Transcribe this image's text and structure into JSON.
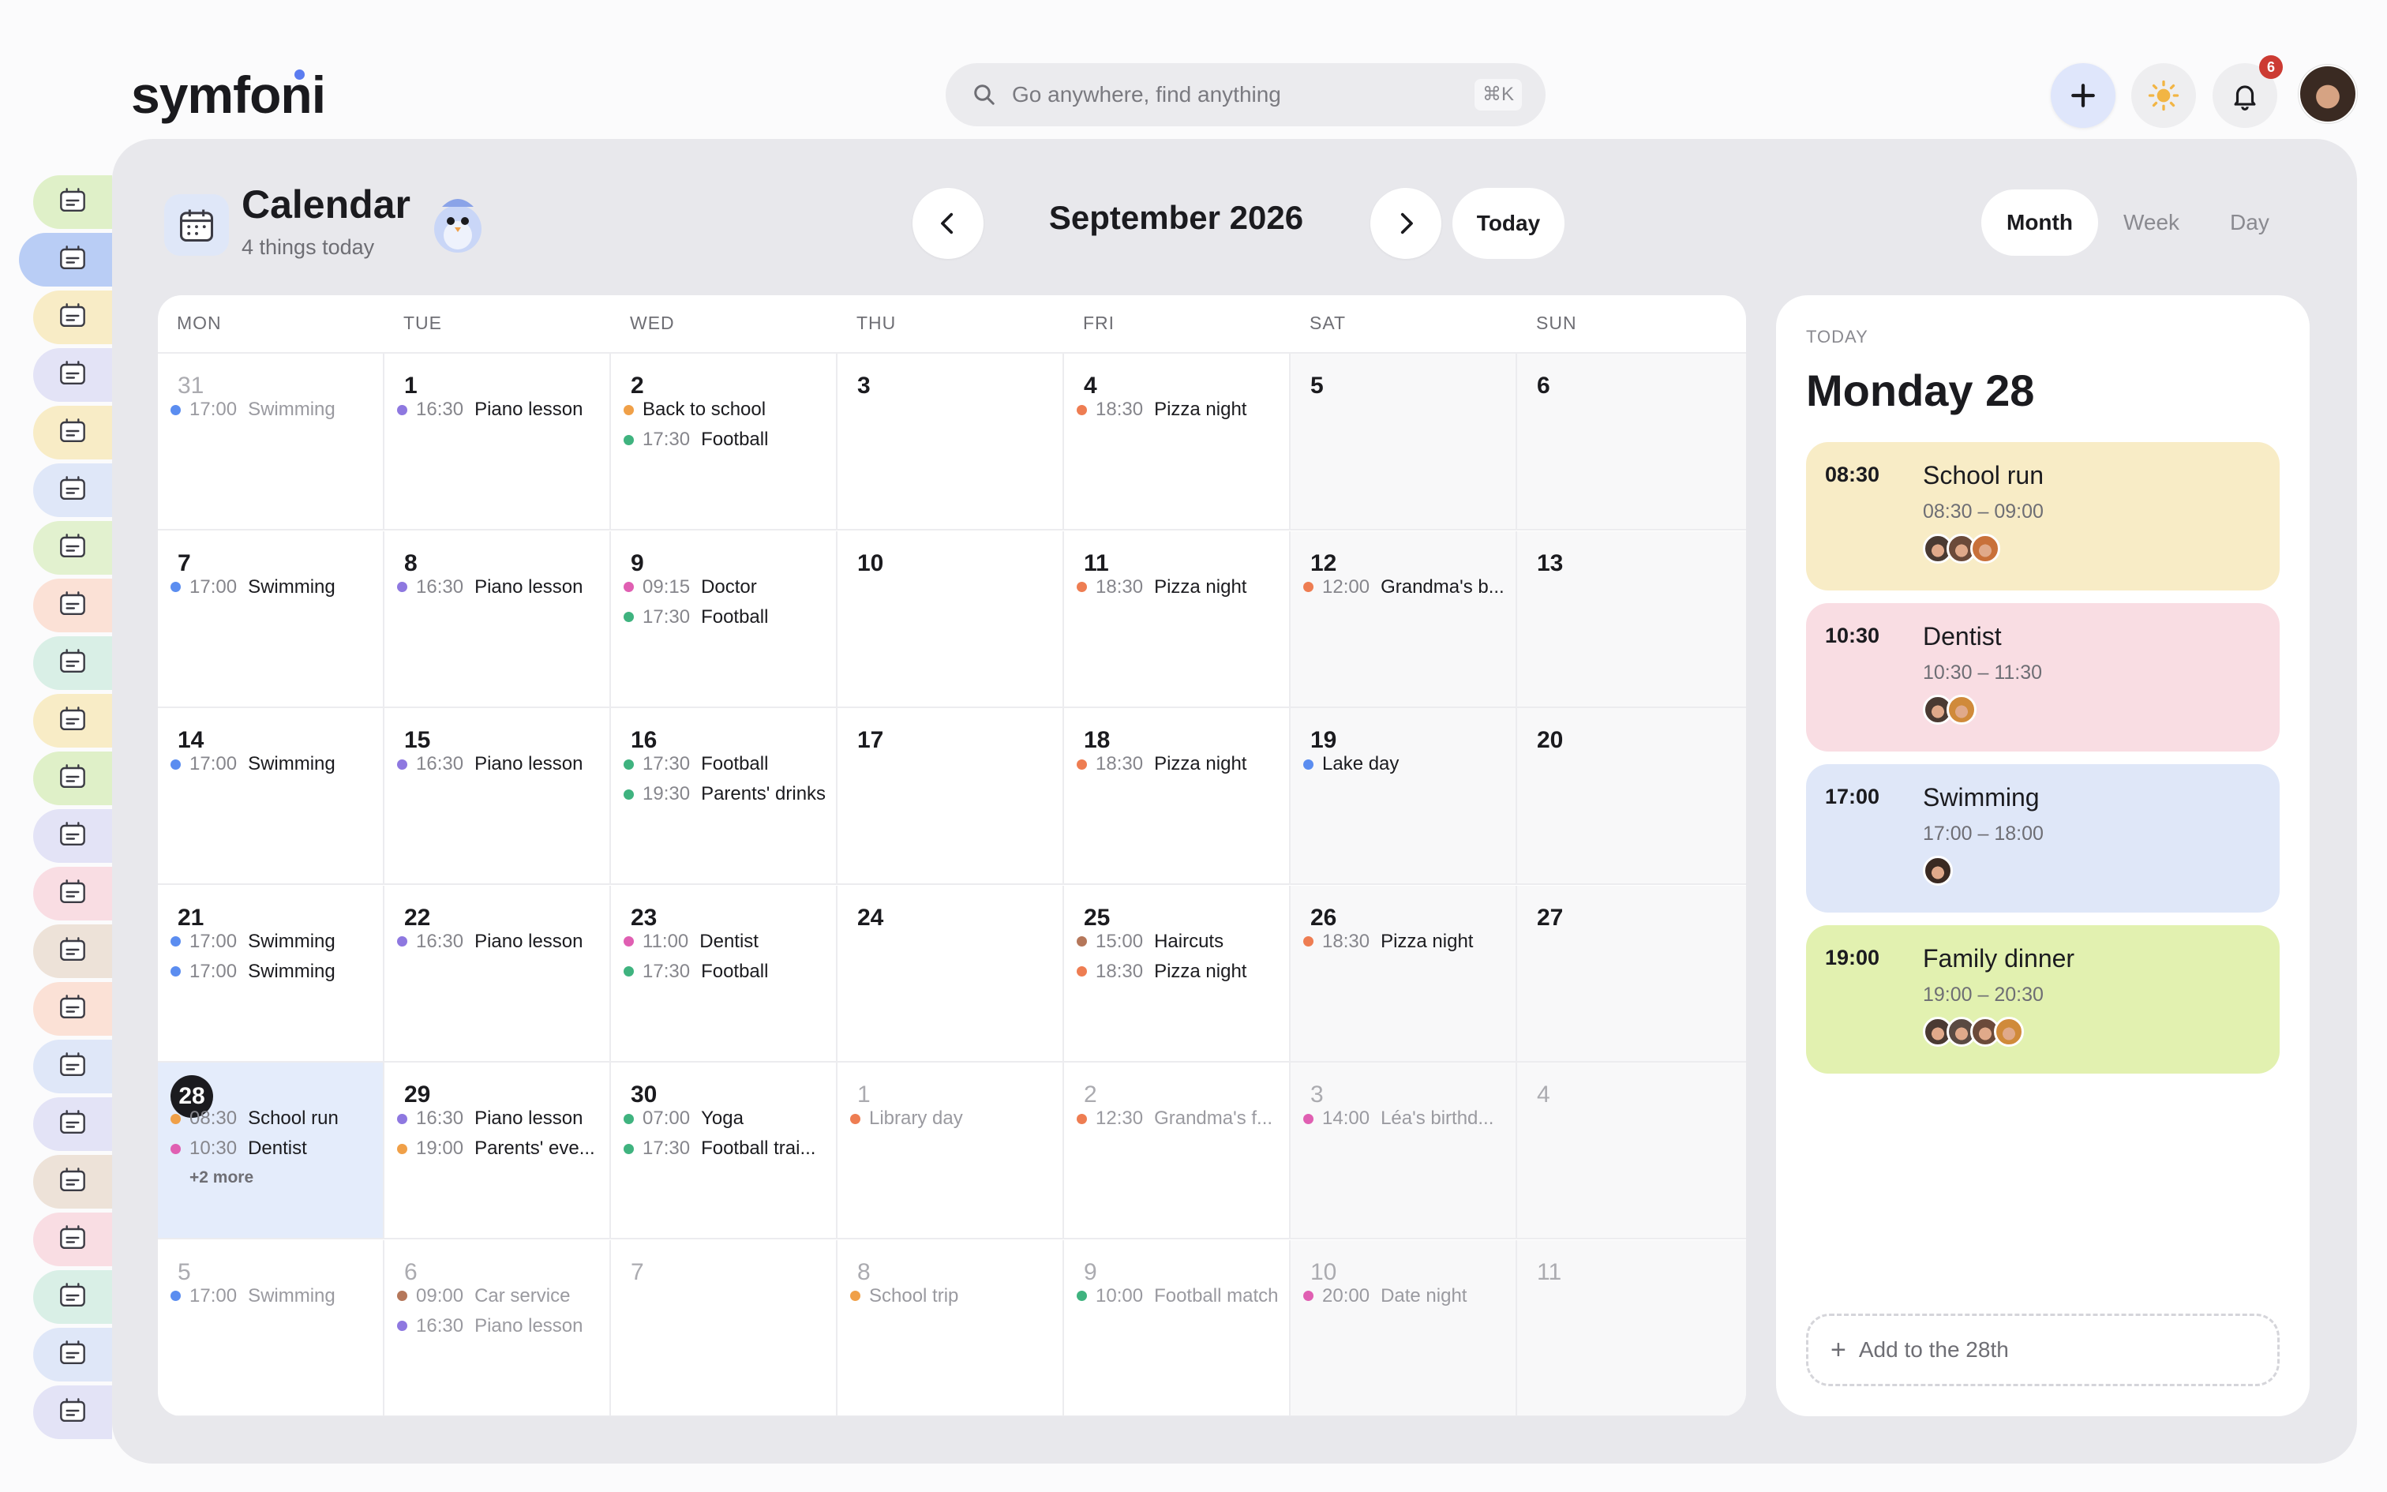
{
  "app": {
    "logo_text": "symfoni"
  },
  "search": {
    "placeholder": "Go anywhere, find anything",
    "shortcut": "⌘K"
  },
  "topbar": {
    "notification_count": "6"
  },
  "sidebar": {
    "items": [
      {
        "icon": "home-icon",
        "bg": "#dff0c8"
      },
      {
        "icon": "calendar-icon",
        "bg": "#b9cdf5",
        "active": true
      },
      {
        "icon": "tickets-icon",
        "bg": "#f8ecc6"
      },
      {
        "icon": "car-icon",
        "bg": "#e3e3f6"
      },
      {
        "icon": "broom-icon",
        "bg": "#f8ecc6"
      },
      {
        "icon": "checklist-icon",
        "bg": "#dfe7f8"
      },
      {
        "icon": "recipe-icon",
        "bg": "#e2f1cf"
      },
      {
        "icon": "plate-icon",
        "bg": "#fbe1d6"
      },
      {
        "icon": "planner-icon",
        "bg": "#d9efe6"
      },
      {
        "icon": "backpack-icon",
        "bg": "#f8ecc6"
      },
      {
        "icon": "vehicle-icon",
        "bg": "#dff0c8"
      },
      {
        "icon": "garden-icon",
        "bg": "#e3e3f6"
      },
      {
        "icon": "camera-icon",
        "bg": "#f9dde3"
      },
      {
        "icon": "toolbox-icon",
        "bg": "#ede2d8"
      },
      {
        "icon": "pet-icon",
        "bg": "#fbe1d6"
      },
      {
        "icon": "weather-icon",
        "bg": "#dfe7f8"
      },
      {
        "icon": "book-icon",
        "bg": "#e3e3f6"
      },
      {
        "icon": "photo-icon",
        "bg": "#ede2d8"
      },
      {
        "icon": "mail-heart-icon",
        "bg": "#f9dde3"
      },
      {
        "icon": "house-care-icon",
        "bg": "#d9efe6"
      },
      {
        "icon": "reading-icon",
        "bg": "#dfe7f8"
      },
      {
        "icon": "baby-icon",
        "bg": "#e3e3f6"
      }
    ]
  },
  "header": {
    "title": "Calendar",
    "subtitle": "4 things today",
    "month_label": "September 2026",
    "today_label": "Today"
  },
  "views": [
    "Month",
    "Week",
    "Day"
  ],
  "selected_view": "Month",
  "weekdays": [
    "MON",
    "TUE",
    "WED",
    "THU",
    "FRI",
    "SAT",
    "SUN"
  ],
  "colors": {
    "blue": "#5b8df0",
    "purple": "#8e78e0",
    "orange": "#f0a048",
    "green": "#3fb37f",
    "coral": "#ee7d52",
    "pink": "#e05fb2",
    "brown": "#b5775a"
  },
  "weeks": [
    [
      {
        "day": "31",
        "muted": true,
        "events": [
          {
            "time": "17:00",
            "name": "Swimming",
            "color": "#5b8df0"
          }
        ]
      },
      {
        "day": "1",
        "events": [
          {
            "time": "16:30",
            "name": "Piano lesson",
            "color": "#8e78e0"
          }
        ]
      },
      {
        "day": "2",
        "events": [
          {
            "time": "",
            "name": "Back to school",
            "color": "#f0a048"
          },
          {
            "time": "17:30",
            "name": "Football",
            "color": "#3fb37f"
          }
        ]
      },
      {
        "day": "3",
        "events": []
      },
      {
        "day": "4",
        "events": [
          {
            "time": "18:30",
            "name": "Pizza night",
            "color": "#ee7d52"
          }
        ]
      },
      {
        "day": "5",
        "weekend": true,
        "events": []
      },
      {
        "day": "6",
        "weekend": true,
        "events": []
      }
    ],
    [
      {
        "day": "7",
        "events": [
          {
            "time": "17:00",
            "name": "Swimming",
            "color": "#5b8df0"
          }
        ]
      },
      {
        "day": "8",
        "events": [
          {
            "time": "16:30",
            "name": "Piano lesson",
            "color": "#8e78e0"
          }
        ]
      },
      {
        "day": "9",
        "events": [
          {
            "time": "09:15",
            "name": "Doctor",
            "color": "#e05fb2"
          },
          {
            "time": "17:30",
            "name": "Football",
            "color": "#3fb37f"
          }
        ]
      },
      {
        "day": "10",
        "events": []
      },
      {
        "day": "11",
        "events": [
          {
            "time": "18:30",
            "name": "Pizza night",
            "color": "#ee7d52"
          }
        ]
      },
      {
        "day": "12",
        "weekend": true,
        "events": [
          {
            "time": "12:00",
            "name": "Grandma's b...",
            "color": "#ee7d52"
          }
        ]
      },
      {
        "day": "13",
        "weekend": true,
        "events": []
      }
    ],
    [
      {
        "day": "14",
        "events": [
          {
            "time": "17:00",
            "name": "Swimming",
            "color": "#5b8df0"
          }
        ]
      },
      {
        "day": "15",
        "events": [
          {
            "time": "16:30",
            "name": "Piano lesson",
            "color": "#8e78e0"
          }
        ]
      },
      {
        "day": "16",
        "events": [
          {
            "time": "17:30",
            "name": "Football",
            "color": "#3fb37f"
          },
          {
            "time": "19:30",
            "name": "Parents' drinks",
            "color": "#3fb37f"
          }
        ]
      },
      {
        "day": "17",
        "events": []
      },
      {
        "day": "18",
        "events": [
          {
            "time": "18:30",
            "name": "Pizza night",
            "color": "#ee7d52"
          }
        ]
      },
      {
        "day": "19",
        "weekend": true,
        "events": [
          {
            "time": "",
            "name": "Lake day",
            "color": "#5b8df0"
          }
        ]
      },
      {
        "day": "20",
        "weekend": true,
        "events": []
      }
    ],
    [
      {
        "day": "21",
        "events": [
          {
            "time": "17:00",
            "name": "Swimming",
            "color": "#5b8df0"
          },
          {
            "time": "17:00",
            "name": "Swimming",
            "color": "#5b8df0"
          }
        ]
      },
      {
        "day": "22",
        "events": [
          {
            "time": "16:30",
            "name": "Piano lesson",
            "color": "#8e78e0"
          }
        ]
      },
      {
        "day": "23",
        "events": [
          {
            "time": "11:00",
            "name": "Dentist",
            "color": "#e05fb2"
          },
          {
            "time": "17:30",
            "name": "Football",
            "color": "#3fb37f"
          }
        ]
      },
      {
        "day": "24",
        "events": []
      },
      {
        "day": "25",
        "events": [
          {
            "time": "15:00",
            "name": "Haircuts",
            "color": "#b5775a"
          },
          {
            "time": "18:30",
            "name": "Pizza night",
            "color": "#ee7d52"
          }
        ]
      },
      {
        "day": "26",
        "weekend": true,
        "events": [
          {
            "time": "18:30",
            "name": "Pizza night",
            "color": "#ee7d52"
          }
        ]
      },
      {
        "day": "27",
        "weekend": true,
        "events": []
      }
    ],
    [
      {
        "day": "28",
        "today": true,
        "events": [
          {
            "time": "08:30",
            "name": "School run",
            "color": "#f0a048"
          },
          {
            "time": "10:30",
            "name": "Dentist",
            "color": "#e05fb2"
          }
        ],
        "more": "+2 more"
      },
      {
        "day": "29",
        "events": [
          {
            "time": "16:30",
            "name": "Piano lesson",
            "color": "#8e78e0"
          },
          {
            "time": "19:00",
            "name": "Parents' eve...",
            "color": "#f0a048"
          }
        ]
      },
      {
        "day": "30",
        "events": [
          {
            "time": "07:00",
            "name": "Yoga",
            "color": "#3fb37f"
          },
          {
            "time": "17:30",
            "name": "Football trai...",
            "color": "#3fb37f"
          }
        ]
      },
      {
        "day": "1",
        "muted": true,
        "events": [
          {
            "time": "",
            "name": "Library day",
            "color": "#ee7d52"
          }
        ]
      },
      {
        "day": "2",
        "muted": true,
        "events": [
          {
            "time": "12:30",
            "name": "Grandma's f...",
            "color": "#ee7d52"
          }
        ]
      },
      {
        "day": "3",
        "muted": true,
        "weekend": true,
        "events": [
          {
            "time": "14:00",
            "name": "Léa's birthd...",
            "color": "#e05fb2"
          }
        ]
      },
      {
        "day": "4",
        "muted": true,
        "weekend": true,
        "events": []
      }
    ],
    [
      {
        "day": "5",
        "muted": true,
        "events": [
          {
            "time": "17:00",
            "name": "Swimming",
            "color": "#5b8df0"
          }
        ]
      },
      {
        "day": "6",
        "muted": true,
        "events": [
          {
            "time": "09:00",
            "name": "Car service",
            "color": "#b5775a"
          },
          {
            "time": "16:30",
            "name": "Piano lesson",
            "color": "#8e78e0"
          }
        ]
      },
      {
        "day": "7",
        "muted": true,
        "events": []
      },
      {
        "day": "8",
        "muted": true,
        "events": [
          {
            "time": "",
            "name": "School trip",
            "color": "#f0a048"
          }
        ]
      },
      {
        "day": "9",
        "muted": true,
        "events": [
          {
            "time": "10:00",
            "name": "Football match",
            "color": "#3fb37f"
          }
        ]
      },
      {
        "day": "10",
        "muted": true,
        "weekend": true,
        "events": [
          {
            "time": "20:00",
            "name": "Date night",
            "color": "#e05fb2"
          }
        ]
      },
      {
        "day": "11",
        "muted": true,
        "weekend": true,
        "events": []
      }
    ]
  ],
  "today_panel": {
    "label": "TODAY",
    "day_title": "Monday 28",
    "events": [
      {
        "time": "08:30",
        "title": "School run",
        "range": "08:30 – 09:00",
        "bg": "#f8ecc6",
        "faces": [
          "#4a3a32",
          "#6b4a3a",
          "#c8703a"
        ]
      },
      {
        "time": "10:30",
        "title": "Dentist",
        "range": "10:30 – 11:30",
        "bg": "#f9dde3",
        "faces": [
          "#4a3a32",
          "#d08a3a"
        ]
      },
      {
        "time": "17:00",
        "title": "Swimming",
        "range": "17:00 – 18:00",
        "bg": "#dfe7f8",
        "faces": [
          "#3a2a22"
        ]
      },
      {
        "time": "19:00",
        "title": "Family dinner",
        "range": "19:00 – 20:30",
        "bg": "#e2f1b0",
        "faces": [
          "#4a3a32",
          "#5a4a42",
          "#6b4a3a",
          "#d08a3a"
        ]
      }
    ],
    "add_label": "Add to the 28th"
  }
}
